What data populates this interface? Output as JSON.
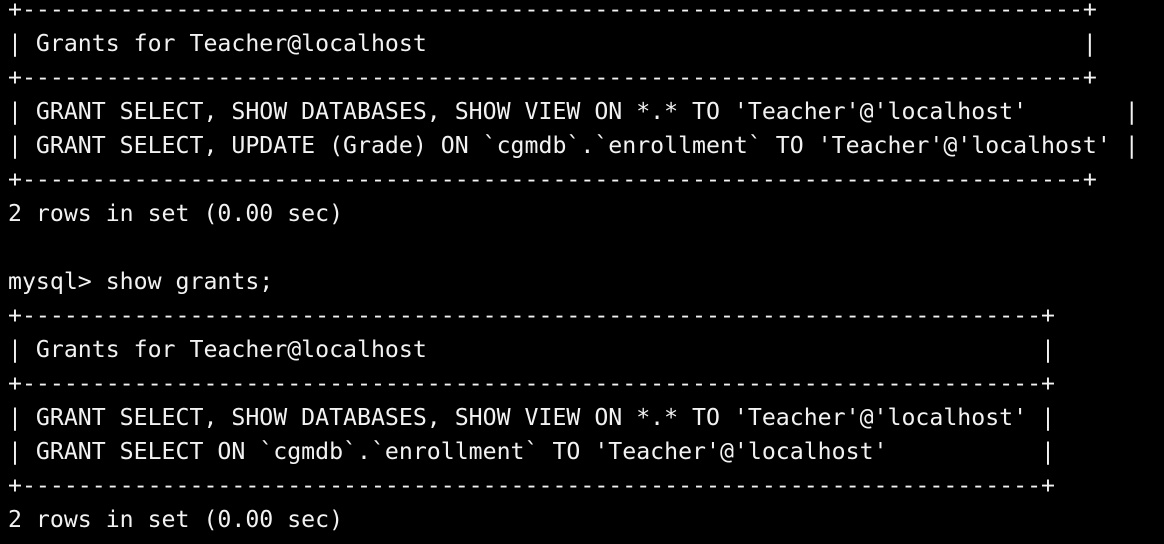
{
  "terminal": {
    "colors": {
      "background": "#000000",
      "foreground": "#f2f2f2"
    },
    "lines": [
      "+----------------------------------------------------------------------------+",
      "| Grants for Teacher@localhost                                               |",
      "+----------------------------------------------------------------------------+",
      "| GRANT SELECT, SHOW DATABASES, SHOW VIEW ON *.* TO 'Teacher'@'localhost'       |",
      "| GRANT SELECT, UPDATE (Grade) ON `cgmdb`.`enrollment` TO 'Teacher'@'localhost' |",
      "+----------------------------------------------------------------------------+",
      "2 rows in set (0.00 sec)",
      "",
      "mysql> show grants;",
      "+-------------------------------------------------------------------------+",
      "| Grants for Teacher@localhost                                            |",
      "+-------------------------------------------------------------------------+",
      "| GRANT SELECT, SHOW DATABASES, SHOW VIEW ON *.* TO 'Teacher'@'localhost' |",
      "| GRANT SELECT ON `cgmdb`.`enrollment` TO 'Teacher'@'localhost'           |",
      "+-------------------------------------------------------------------------+",
      "2 rows in set (0.00 sec)"
    ]
  }
}
